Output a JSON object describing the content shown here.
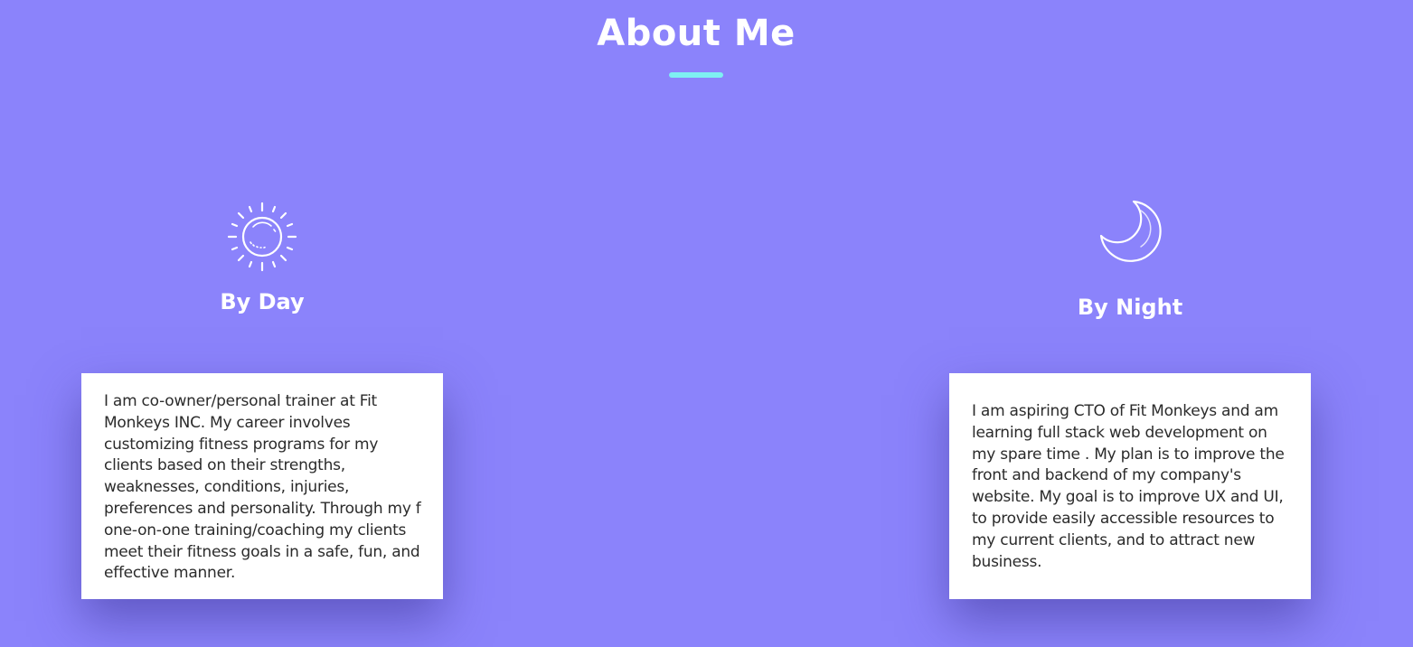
{
  "section": {
    "title": "About Me"
  },
  "colors": {
    "background": "#8b83fb",
    "accent_underline": "#7ef0f2",
    "card": "#ffffff",
    "text": "#2b2b2b"
  },
  "day": {
    "icon": "sun-icon",
    "heading": "By Day",
    "text": "I am co-owner/personal trainer at Fit Monkeys INC. My career involves customizing fitness programs for my clients based on their strengths, weaknesses, conditions, injuries, preferences and personality. Through my f one-on-one training/coaching my clients meet their fitness goals in a safe, fun, and effective manner."
  },
  "night": {
    "icon": "moon-icon",
    "heading": "By Night",
    "text": "I am aspiring CTO of Fit Monkeys and am learning full stack web development on my spare time . My plan is to improve the front and backend of my company's website. My goal is to improve UX and UI, to provide easily accessible resources to my current clients, and to attract new business."
  }
}
